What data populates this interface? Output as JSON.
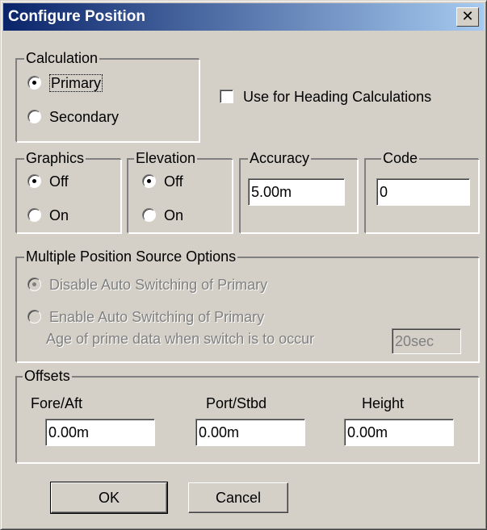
{
  "window": {
    "title": "Configure Position",
    "close_glyph": "✕",
    "accent": "#0a246a"
  },
  "calculation": {
    "legend": "Calculation",
    "options": [
      "Primary",
      "Secondary"
    ],
    "selected": "Primary"
  },
  "heading": {
    "label": "Use for Heading Calculations",
    "checked": false
  },
  "graphics": {
    "legend": "Graphics",
    "options": [
      "Off",
      "On"
    ],
    "selected": "Off"
  },
  "elevation": {
    "legend": "Elevation",
    "options": [
      "Off",
      "On"
    ],
    "selected": "Off"
  },
  "accuracy": {
    "legend": "Accuracy",
    "value": "5.00m"
  },
  "code": {
    "legend": "Code",
    "value": "0"
  },
  "multi_source": {
    "legend": "Multiple Position Source Options",
    "disable_label": "Disable Auto Switching of Primary",
    "enable_label": "Enable Auto Switching of Primary",
    "selected": "Disable Auto Switching of Primary",
    "age_label": "Age of prime data when switch is to occur",
    "age_value": "20sec",
    "enabled": false
  },
  "offsets": {
    "legend": "Offsets",
    "fields": [
      {
        "label": "Fore/Aft",
        "value": "0.00m"
      },
      {
        "label": "Port/Stbd",
        "value": "0.00m"
      },
      {
        "label": "Height",
        "value": "0.00m"
      }
    ]
  },
  "buttons": {
    "ok": "OK",
    "cancel": "Cancel"
  }
}
